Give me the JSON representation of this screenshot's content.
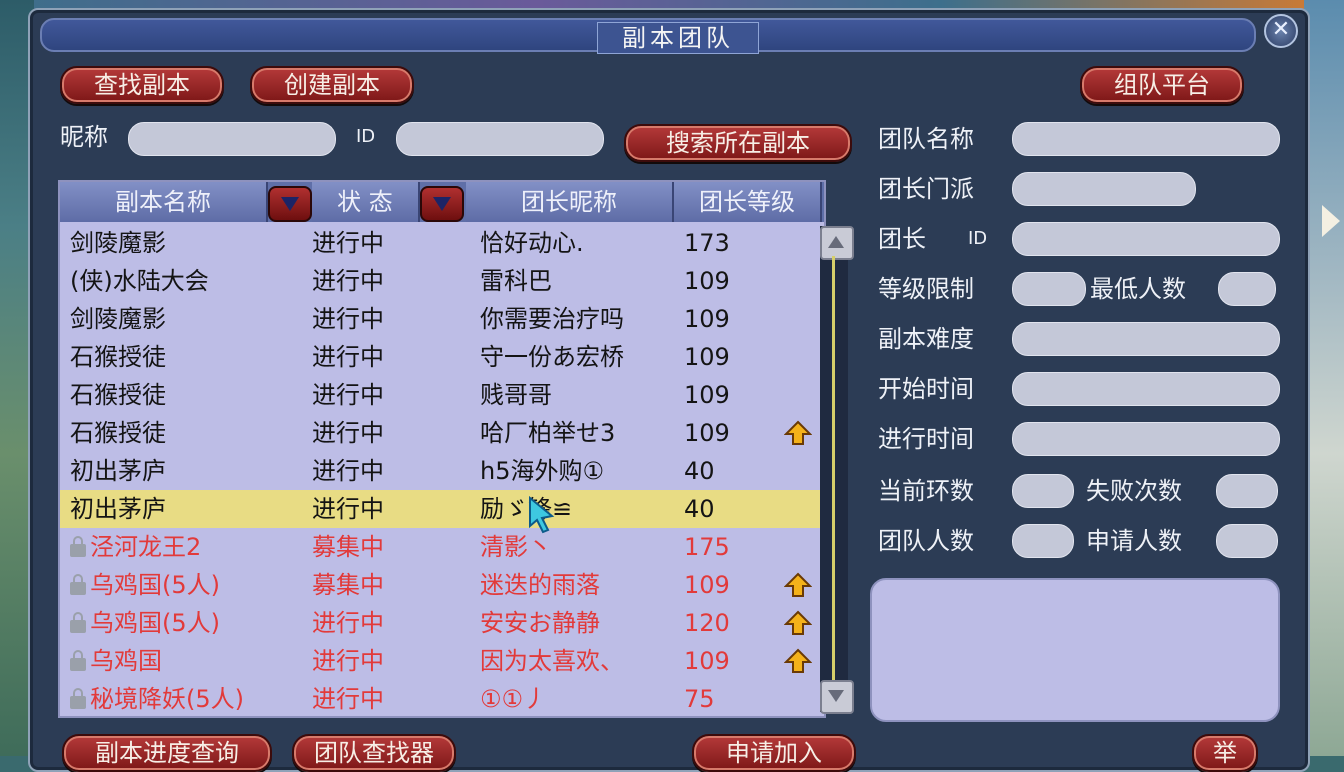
{
  "window": {
    "title": "副本团队",
    "close_label": "✕"
  },
  "toolbar": {
    "find": "查找副本",
    "create": "创建副本",
    "platform": "组队平台"
  },
  "search": {
    "nickname_label": "昵称",
    "id_label": "ID",
    "nickname_value": "",
    "id_value": "",
    "search_button": "搜索所在副本"
  },
  "table": {
    "headers": [
      "副本名称",
      "状 态",
      "团长昵称",
      "团长等级"
    ],
    "rows": [
      {
        "name": "剑陵魔影",
        "status": "进行中",
        "leader": "恰好动心.",
        "level": "173",
        "locked": false,
        "red": false,
        "selected": false,
        "up": false
      },
      {
        "name": "(侠)水陆大会",
        "status": "进行中",
        "leader": "雷科巴",
        "level": "109",
        "locked": false,
        "red": false,
        "selected": false,
        "up": false
      },
      {
        "name": "剑陵魔影",
        "status": "进行中",
        "leader": "你需要治疗吗",
        "level": "109",
        "locked": false,
        "red": false,
        "selected": false,
        "up": false
      },
      {
        "name": "石猴授徒",
        "status": "进行中",
        "leader": "守一份あ宏桥",
        "level": "109",
        "locked": false,
        "red": false,
        "selected": false,
        "up": false
      },
      {
        "name": "石猴授徒",
        "status": "进行中",
        "leader": "贱哥哥",
        "level": "109",
        "locked": false,
        "red": false,
        "selected": false,
        "up": false
      },
      {
        "name": "石猴授徒",
        "status": "进行中",
        "leader": "哈厂柏举せ3",
        "level": "109",
        "locked": false,
        "red": false,
        "selected": false,
        "up": true
      },
      {
        "name": "初出茅庐",
        "status": "进行中",
        "leader": "h5海外购①",
        "level": "40",
        "locked": false,
        "red": false,
        "selected": false,
        "up": false
      },
      {
        "name": "初出茅庐",
        "status": "进行中",
        "leader": "励ゞ锋≌",
        "level": "40",
        "locked": false,
        "red": false,
        "selected": true,
        "up": false
      },
      {
        "name": "泾河龙王2",
        "status": "募集中",
        "leader": "清影丶",
        "level": "175",
        "locked": true,
        "red": true,
        "selected": false,
        "up": false
      },
      {
        "name": "乌鸡国(5人)",
        "status": "募集中",
        "leader": "迷迭的雨落",
        "level": "109",
        "locked": true,
        "red": true,
        "selected": false,
        "up": true
      },
      {
        "name": "乌鸡国(5人)",
        "status": "进行中",
        "leader": "安安お静静",
        "level": "120",
        "locked": true,
        "red": true,
        "selected": false,
        "up": true
      },
      {
        "name": "乌鸡国",
        "status": "进行中",
        "leader": "因为太喜欢、",
        "level": "109",
        "locked": true,
        "red": true,
        "selected": false,
        "up": true
      },
      {
        "name": "秘境降妖(5人)",
        "status": "进行中",
        "leader": "①①丿",
        "level": "75",
        "locked": true,
        "red": true,
        "selected": false,
        "up": false
      }
    ]
  },
  "detail": {
    "team_name": "团队名称",
    "leader_school": "团长门派",
    "leader_id_a": "团长",
    "leader_id_b": "ID",
    "level_limit": "等级限制",
    "min_people": "最低人数",
    "difficulty": "副本难度",
    "start_time": "开始时间",
    "run_time": "进行时间",
    "current_round": "当前环数",
    "fail_count": "失败次数",
    "team_count": "团队人数",
    "apply_count": "申请人数"
  },
  "bottom": {
    "progress": "副本进度查询",
    "team_find": "团队查找器",
    "apply": "申请加入",
    "report": "举"
  },
  "colors": {
    "accent_red": "#a32626",
    "row_red": "#e23a3a",
    "selected": "#e8dc84",
    "panel": "#2c3c55"
  }
}
